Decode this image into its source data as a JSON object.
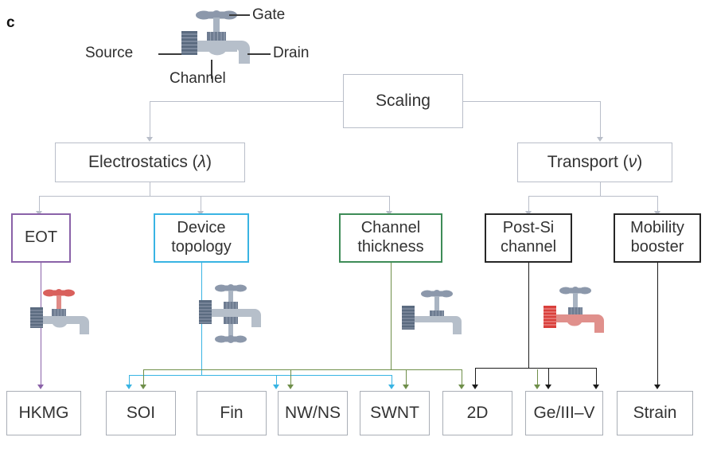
{
  "panel": {
    "letter": "c"
  },
  "device_callouts": {
    "gate": "Gate",
    "source": "Source",
    "drain": "Drain",
    "channel": "Channel"
  },
  "hierarchy": {
    "root": {
      "label": "Scaling"
    },
    "branches": [
      {
        "label": "Electrostatics (",
        "symbol": "λ",
        "suffix": ")",
        "full": "Electrostatics (λ)"
      },
      {
        "label": "Transport (",
        "symbol": "ν",
        "suffix": ")",
        "full": "Transport (ν)"
      }
    ],
    "categories": [
      {
        "id": "eot",
        "label": "EOT",
        "color": "#8a62a8"
      },
      {
        "id": "device-topology",
        "label": "Device topology",
        "color": "#39b4e3"
      },
      {
        "id": "channel-thickness",
        "label": "Channel thickness",
        "color": "#3e8c57"
      },
      {
        "id": "post-si-channel",
        "label": "Post-Si channel",
        "color": "#262626"
      },
      {
        "id": "mobility-booster",
        "label": "Mobility booster",
        "color": "#262626"
      }
    ],
    "technologies": [
      {
        "id": "hkmg",
        "label": "HKMG"
      },
      {
        "id": "soi",
        "label": "SOI"
      },
      {
        "id": "fin",
        "label": "Fin"
      },
      {
        "id": "nwns",
        "label": "NW/NS"
      },
      {
        "id": "swnt",
        "label": "SWNT"
      },
      {
        "id": "2d",
        "label": "2D"
      },
      {
        "id": "geiiiv",
        "label": "Ge/III–V"
      },
      {
        "id": "strain",
        "label": "Strain"
      }
    ]
  },
  "icons": {
    "top_faucet": "faucet-icon",
    "eot_faucet": "faucet-red-handle-icon",
    "topology_faucet": "faucet-double-gate-icon",
    "thickness_faucet": "faucet-thin-body-icon",
    "postsi_faucet": "faucet-red-body-icon"
  },
  "colors": {
    "grey_line": "#b9bec9",
    "purple": "#8a62a8",
    "cyan": "#39b4e3",
    "green": "#3e8c57",
    "green_line": "#6f8f4a",
    "black": "#1c1c1c",
    "faucet_body": "#b6bfca",
    "faucet_dark": "#5b6b80",
    "faucet_red": "#d9605c",
    "faucet_red_body": "#e0908c"
  }
}
